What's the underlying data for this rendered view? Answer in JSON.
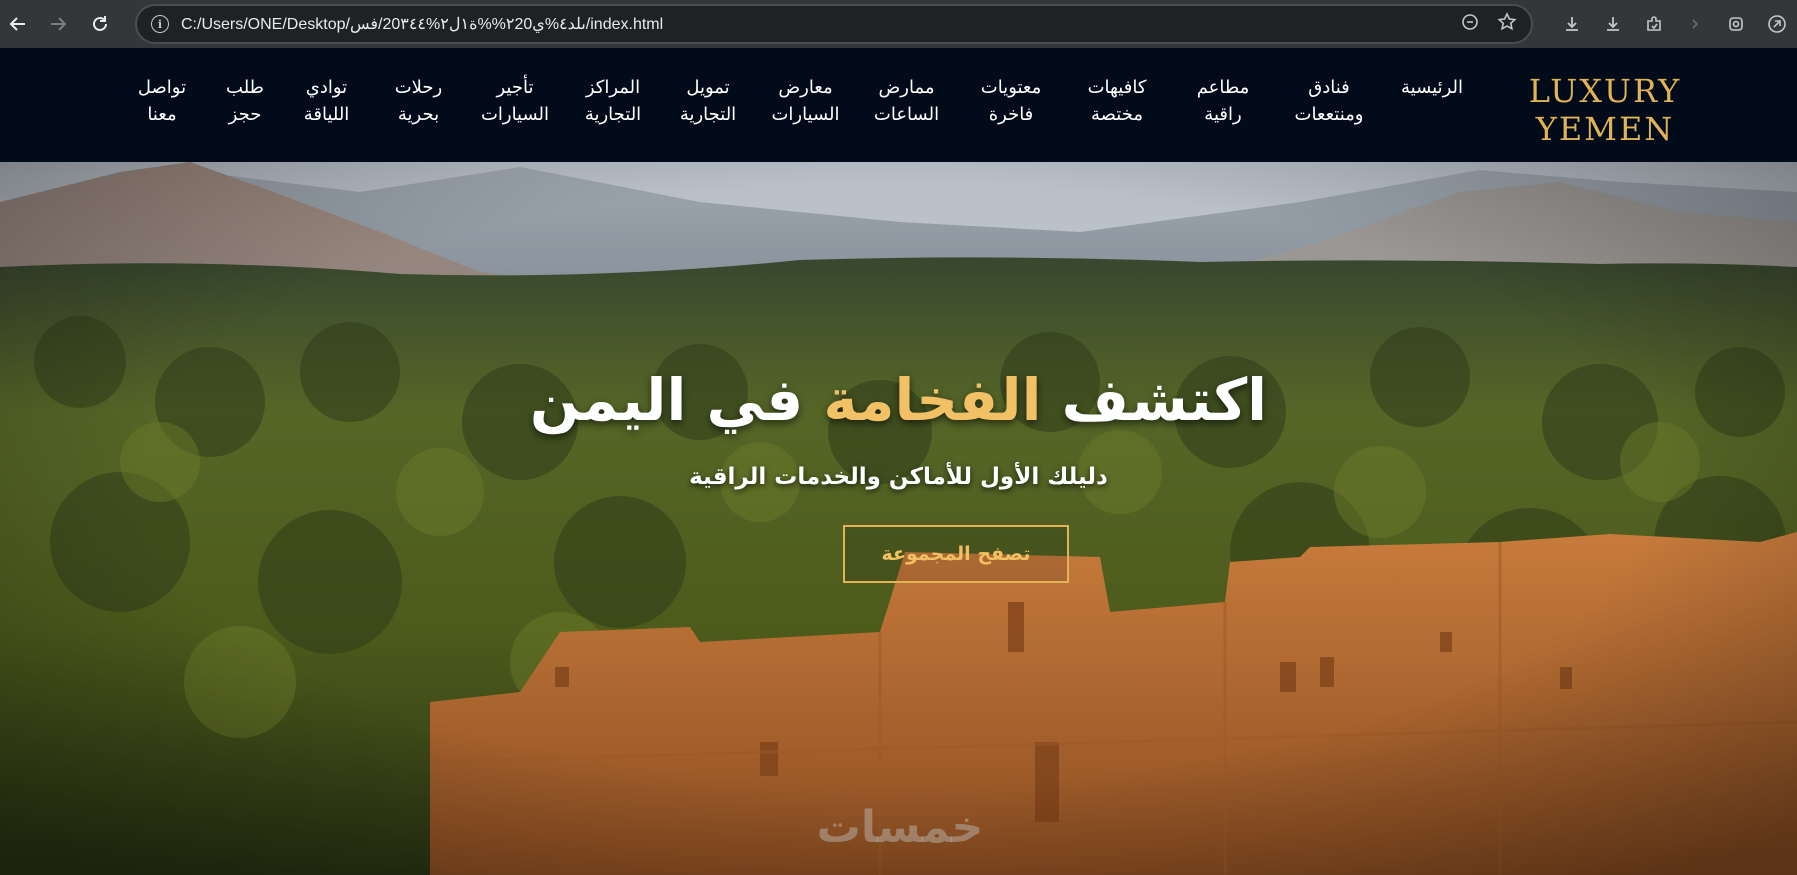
{
  "browser": {
    "url": "C:/Users/ONE/Desktop/ىلد٤%ي٢20%%ة١ل٢%20٣٤٤/فس/index.html",
    "icons": {
      "back": "arrow-left-icon",
      "forward": "arrow-right-icon",
      "reload": "reload-icon",
      "info": "info-icon",
      "zoom": "zoom-icon",
      "bookmark": "star-icon",
      "download": "download-icon",
      "download2": "download-icon",
      "extensions": "puzzle-icon",
      "chevron": "chevron-right-icon",
      "shield": "shield-icon",
      "profile": "profile-icon"
    }
  },
  "site": {
    "logo_line1": "LUXURY",
    "logo_line2": "YEMEN",
    "nav": [
      {
        "label": "الرئيسية"
      },
      {
        "label": "فنادق\nومنتععات"
      },
      {
        "label": "مطاعم\nراقية"
      },
      {
        "label": "كافيهات\nمختصة"
      },
      {
        "label": "معتويات\nفاخرة"
      },
      {
        "label": "ممارض\nالساعات"
      },
      {
        "label": "معارض\nالسيارات"
      },
      {
        "label": "تمويل\nالتجارية"
      },
      {
        "label": "المراكز\nالتجارية"
      },
      {
        "label": "تأجير\nالسيارات"
      },
      {
        "label": "رحلات\nبحرية"
      },
      {
        "label": "توادي\nاللياقة"
      },
      {
        "label": "طلب\nحجز"
      },
      {
        "label": "تواصل\nمعنا"
      }
    ],
    "colors": {
      "accent": "#e2b356",
      "header_bg": "#020b1a"
    }
  },
  "hero": {
    "title_part1": "اكتشف",
    "title_accent": "الفخامة",
    "title_part2": "في اليمن",
    "subtitle": "دليلك الأول للأماكن والخدمات الراقية",
    "cta": "تصفح المجموعة",
    "watermark": "خمسات"
  }
}
